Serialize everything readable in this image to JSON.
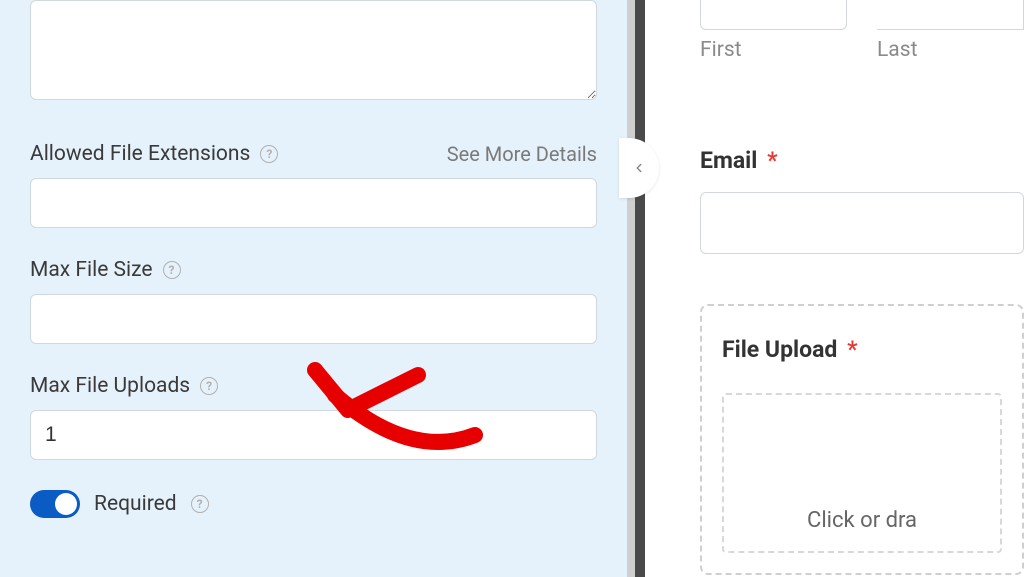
{
  "leftPanel": {
    "allowedExtensions": {
      "label": "Allowed File Extensions",
      "seeMore": "See More Details",
      "value": ""
    },
    "maxFileSize": {
      "label": "Max File Size",
      "value": ""
    },
    "maxFileUploads": {
      "label": "Max File Uploads",
      "value": "1"
    },
    "required": {
      "label": "Required",
      "checked": true
    }
  },
  "rightPanel": {
    "name": {
      "firstLabel": "First",
      "lastLabel": "Last"
    },
    "email": {
      "label": "Email"
    },
    "fileUpload": {
      "label": "File Upload",
      "dropzoneText": "Click or dra"
    }
  },
  "icons": {
    "help": "?",
    "requiredStar": "*"
  }
}
